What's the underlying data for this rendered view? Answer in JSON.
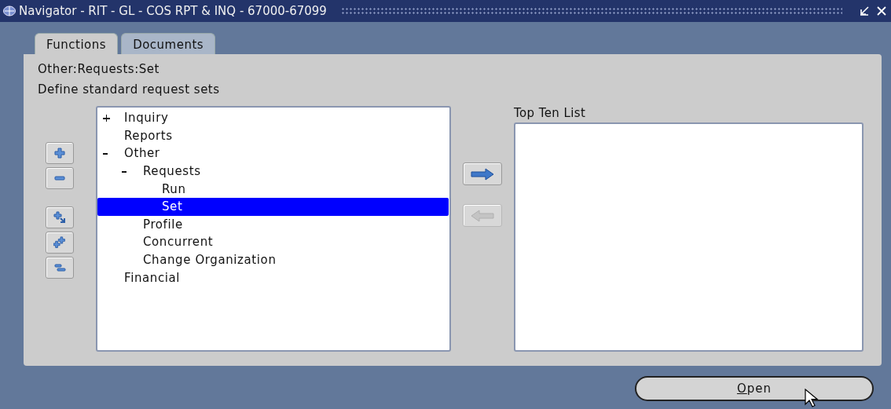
{
  "window": {
    "title": "Navigator - RIT - GL - COS RPT & INQ - 67000-67099"
  },
  "tabs": [
    {
      "label": "Functions",
      "selected": true
    },
    {
      "label": "Documents",
      "selected": false
    }
  ],
  "path": "Other:Requests:Set",
  "description": "Define standard request sets",
  "tree": [
    {
      "label": "Inquiry",
      "expanded": false,
      "selected": false
    },
    {
      "label": "Reports",
      "selected": false
    },
    {
      "label": "Other",
      "expanded": true,
      "selected": false,
      "children": [
        {
          "label": "Requests",
          "expanded": true,
          "selected": false,
          "children": [
            {
              "label": "Run",
              "selected": false
            },
            {
              "label": "Set",
              "selected": true
            }
          ]
        },
        {
          "label": "Profile",
          "selected": false
        },
        {
          "label": "Concurrent",
          "selected": false
        },
        {
          "label": "Change Organization",
          "selected": false
        }
      ]
    },
    {
      "label": "Financial",
      "selected": false
    }
  ],
  "tree_tools": [
    {
      "kind": "expand"
    },
    {
      "kind": "collapse"
    },
    {
      "kind": "expand-branch"
    },
    {
      "kind": "expand-all"
    },
    {
      "kind": "collapse-all"
    }
  ],
  "transfer_buttons": [
    {
      "kind": "add",
      "disabled": false
    },
    {
      "kind": "remove",
      "disabled": true
    }
  ],
  "top_ten": {
    "label": "Top Ten List"
  },
  "open_button": {
    "label": "Open",
    "mnemonic_underlined": true
  }
}
